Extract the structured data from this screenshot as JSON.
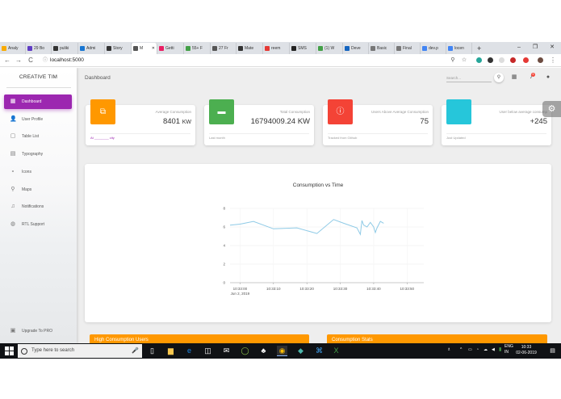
{
  "browser": {
    "tabs": [
      {
        "label": "Analy",
        "color": "#f9ab00"
      },
      {
        "label": "29 Bo",
        "color": "#5f3dc4"
      },
      {
        "label": "puliki",
        "color": "#333333"
      },
      {
        "label": "Admi",
        "color": "#1976d2"
      },
      {
        "label": "Story",
        "color": "#333333"
      },
      {
        "label": "M",
        "color": "#555555"
      },
      {
        "label": "Getti",
        "color": "#e91e63"
      },
      {
        "label": "55+ F",
        "color": "#43a047"
      },
      {
        "label": "27 Fr",
        "color": "#555555"
      },
      {
        "label": "Mate",
        "color": "#333333"
      },
      {
        "label": "reem",
        "color": "#e53935"
      },
      {
        "label": "SMS",
        "color": "#222222"
      },
      {
        "label": "(1) W",
        "color": "#43a047"
      },
      {
        "label": "Deve",
        "color": "#1565c0"
      },
      {
        "label": "Basic",
        "color": "#777777"
      },
      {
        "label": "Final",
        "color": "#777777"
      },
      {
        "label": "dev.p",
        "color": "#4285f4"
      },
      {
        "label": "locen",
        "color": "#4285f4"
      }
    ],
    "url": "localhost:5000"
  },
  "sidebar": {
    "brand": "CREATIVE TIM",
    "items": [
      {
        "label": "Dashboard",
        "icon": "dashboard-icon",
        "glyph": "▦"
      },
      {
        "label": "User Profile",
        "icon": "person-icon",
        "glyph": "👤"
      },
      {
        "label": "Table List",
        "icon": "clipboard-icon",
        "glyph": "▢"
      },
      {
        "label": "Typography",
        "icon": "library-books-icon",
        "glyph": "▤"
      },
      {
        "label": "Icons",
        "icon": "bubble-chart-icon",
        "glyph": "∘"
      },
      {
        "label": "Maps",
        "icon": "location-icon",
        "glyph": "⚲"
      },
      {
        "label": "Notifications",
        "icon": "bell-icon",
        "glyph": "♫"
      },
      {
        "label": "RTL Support",
        "icon": "language-icon",
        "glyph": "◍"
      }
    ],
    "upgrade": "Upgrade To PRO"
  },
  "header": {
    "title": "Dashboard",
    "search_placeholder": "Search...",
    "notification_count": "5"
  },
  "cards": [
    {
      "category": "Average Consumption",
      "value": "8401",
      "unit": "KW",
      "footer": "At ________ city",
      "color": "#ff9800",
      "glyph": "⧉",
      "icon": "content-copy-icon"
    },
    {
      "category": "Total Consumption",
      "value": "16794009.24 KW",
      "unit": "",
      "footer": "Last month",
      "color": "#4caf50",
      "glyph": "▬",
      "icon": "store-icon"
    },
    {
      "category": "Users Above Average Consumption",
      "value": "75",
      "unit": "",
      "footer": "Tracked from Github",
      "color": "#f44336",
      "glyph": "ⓘ",
      "icon": "info-outline-icon"
    },
    {
      "category": "User below average consump",
      "value": "+245",
      "unit": "",
      "footer": "Just Updated",
      "color": "#26c6da",
      "glyph": "",
      "icon": "twitter-icon"
    }
  ],
  "chart_data": {
    "type": "line",
    "title": "Consumption vs Time",
    "xlabel": "",
    "ylabel": "",
    "x_ticks": [
      "10:33:00",
      "10:33:10",
      "10:33:20",
      "10:33:30",
      "10:33:40",
      "10:33:50"
    ],
    "x_subtitle": "Jun 2, 2019",
    "y_ticks": [
      0,
      2,
      4,
      6,
      8
    ],
    "ylim": [
      0,
      8
    ],
    "series": [
      {
        "color": "#8ecae6",
        "x": [
          -3,
          0,
          4,
          10,
          17,
          23,
          28,
          31,
          35,
          36,
          36.5,
          37,
          38,
          39,
          40,
          40.5,
          41,
          42,
          43
        ],
        "y": [
          6.2,
          6.3,
          6.6,
          5.8,
          5.9,
          5.3,
          6.8,
          6.4,
          5.9,
          5.2,
          6.7,
          6.2,
          6.0,
          6.5,
          6.0,
          5.4,
          5.9,
          6.6,
          6.4
        ]
      }
    ],
    "grid": true
  },
  "panels": {
    "left_title": "High Consumption Users",
    "right_title": "Consumption Stats"
  },
  "taskbar": {
    "search_placeholder": "Type here to search",
    "lang": "ENG",
    "region": "IN",
    "time": "10:33",
    "date": "02-06-2019"
  }
}
